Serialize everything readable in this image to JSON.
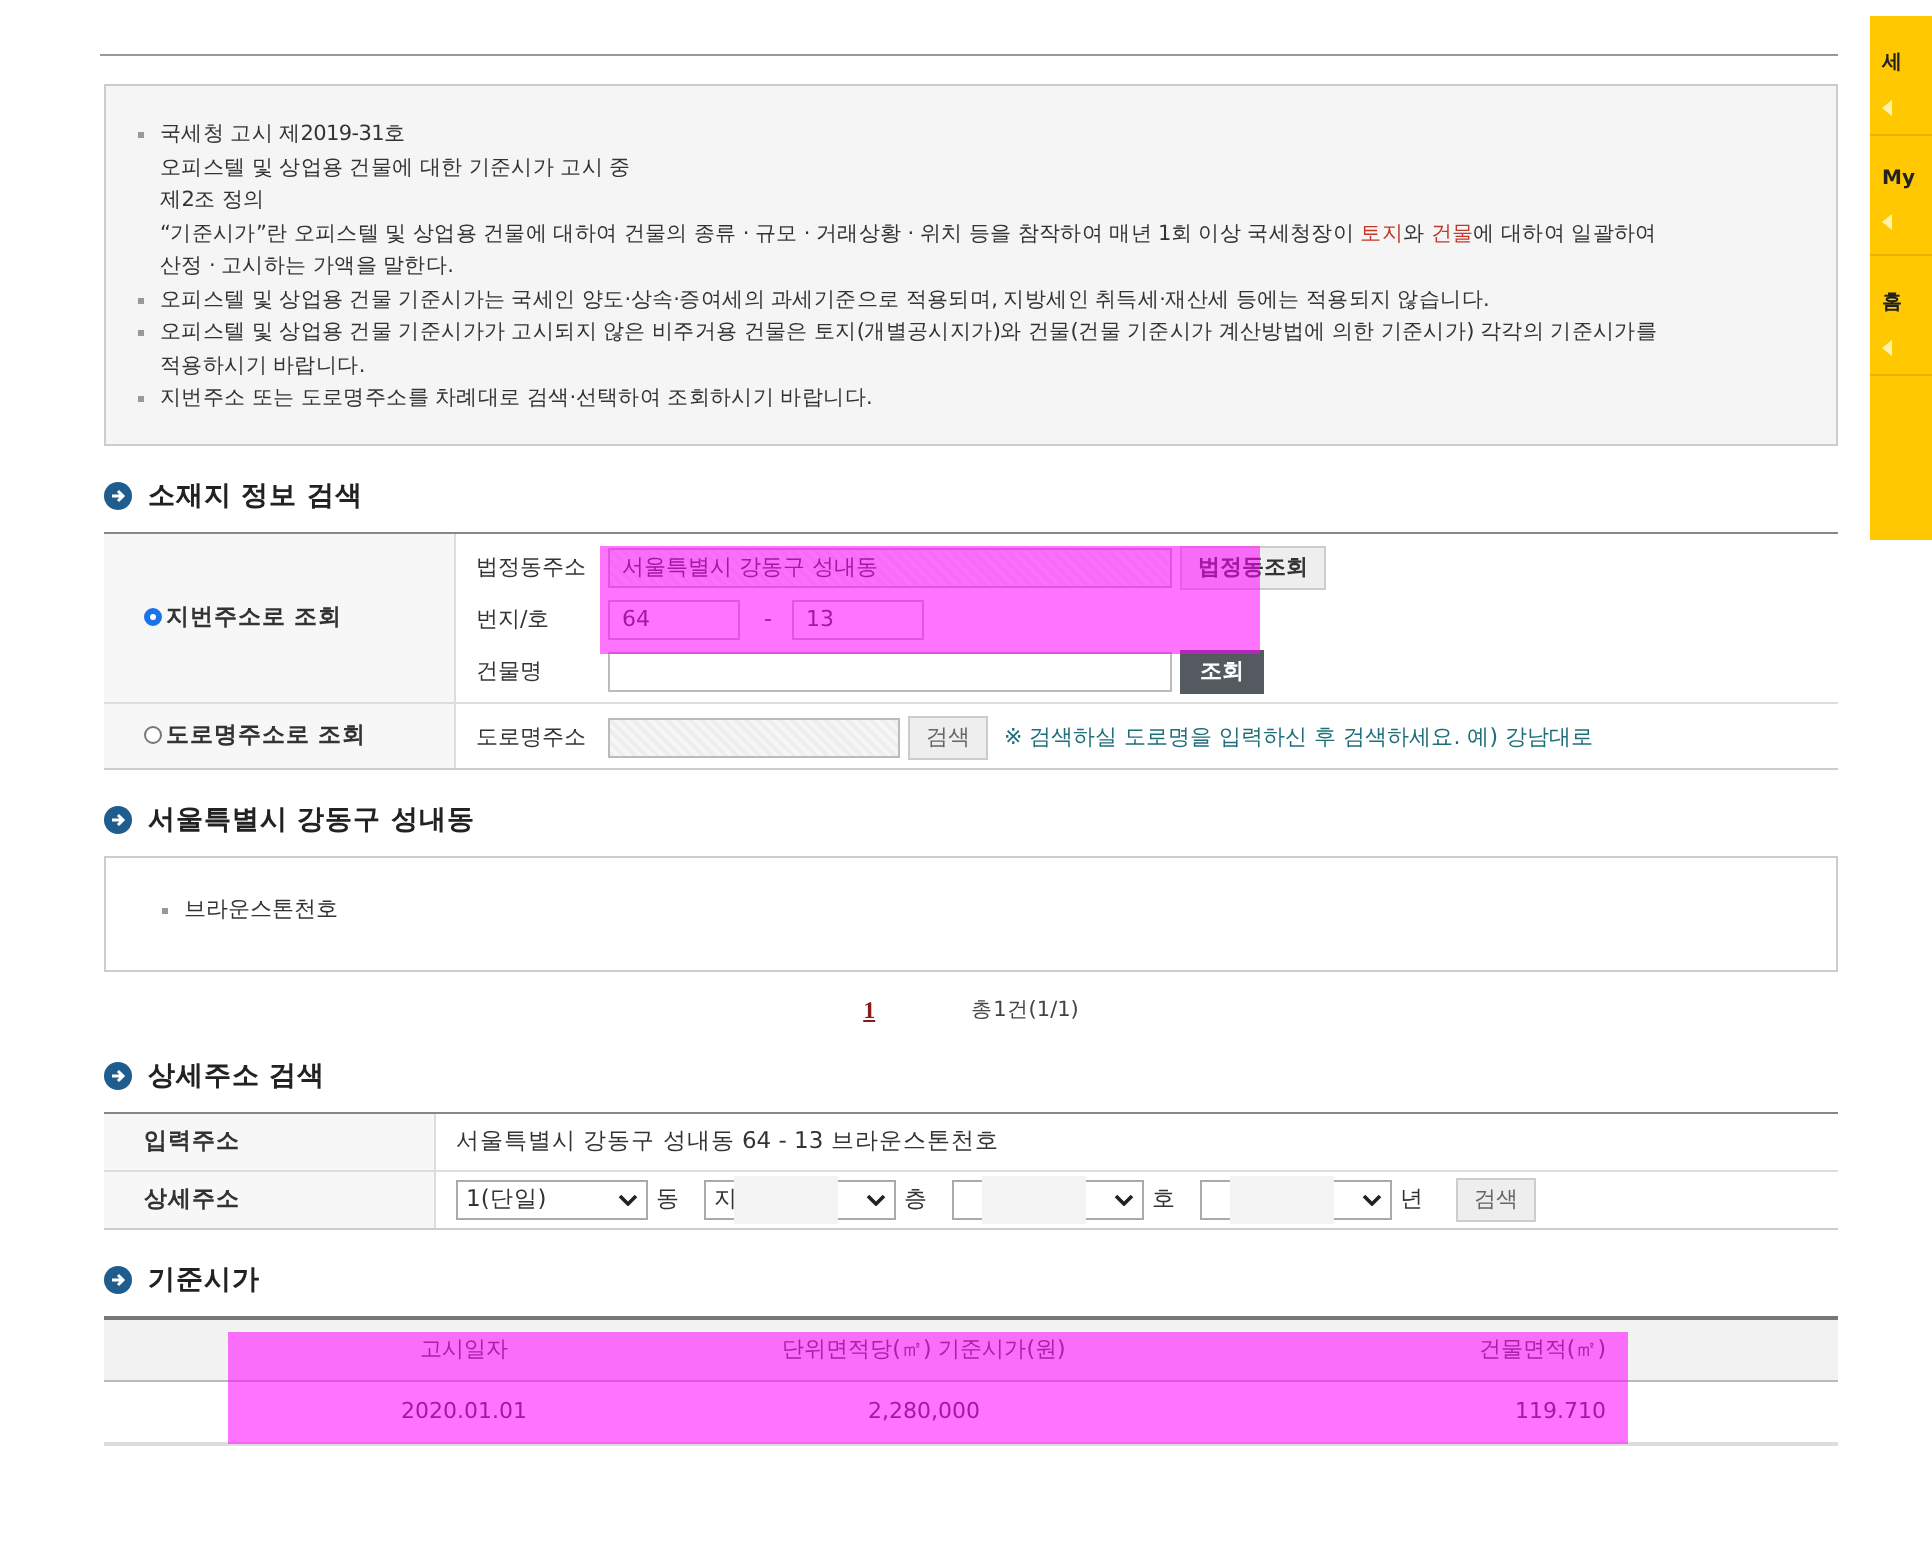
{
  "notice": {
    "items": [
      {
        "lines": [
          [
            {
              "text": "국세청 고시 제2019-31호",
              "emphasis": false
            }
          ],
          [
            {
              "text": "오피스텔 및 상업용 건물에 대한 기준시가 고시 중",
              "emphasis": false
            }
          ],
          [
            {
              "text": "제2조 정의",
              "emphasis": false
            }
          ],
          [
            {
              "text": "“기준시가”란 오피스텔 및 상업용 건물에 대하여 건물의 종류 · 규모 · 거래상황 · 위치 등을 참작하여 매년 1회 이상 국세청장이 ",
              "emphasis": false
            },
            {
              "text": "토지",
              "emphasis": true
            },
            {
              "text": "와 ",
              "emphasis": false
            },
            {
              "text": "건물",
              "emphasis": true
            },
            {
              "text": "에 대하여 일괄하여",
              "emphasis": false
            }
          ],
          [
            {
              "text": "산정 · 고시하는 가액을 말한다.",
              "emphasis": false
            }
          ]
        ]
      },
      {
        "lines": [
          [
            {
              "text": "오피스텔 및 상업용 건물 기준시가는 국세인 양도·상속·증여세의 과세기준으로 적용되며, 지방세인 취득세·재산세 등에는 적용되지 않습니다.",
              "emphasis": false
            }
          ]
        ]
      },
      {
        "lines": [
          [
            {
              "text": "오피스텔 및 상업용 건물 기준시가가 고시되지 않은 비주거용 건물은 토지(개별공시지가)와 건물(건물 기준시가 계산방법에 의한 기준시가) 각각의 기준시가를",
              "emphasis": false
            }
          ],
          [
            {
              "text": "적용하시기 바랍니다.",
              "emphasis": false
            }
          ]
        ]
      },
      {
        "lines": [
          [
            {
              "text": "지번주소 또는 도로명주소를 차례대로 검색·선택하여 조회하시기 바랍니다.",
              "emphasis": false
            }
          ]
        ]
      }
    ]
  },
  "location_search": {
    "title": "소재지 정보 검색",
    "modes": [
      {
        "label": "지번주소로 조회",
        "selected": true,
        "dong_label": "법정동주소",
        "dong_value": "서울특별시 강동구 성내동",
        "dong_button": "법정동조회",
        "lot_label": "번지/호",
        "lot_main": "64",
        "lot_sep": "-",
        "lot_sub": "13",
        "building_label": "건물명",
        "building_button": "조회"
      },
      {
        "label": "도로명주소로 조회",
        "selected": false,
        "road_label": "도로명주소",
        "road_button": "검색",
        "hint": "※ 검색하실 도로명을 입력하신 후 검색하세요. 예) 강남대로"
      }
    ]
  },
  "result": {
    "title": "서울특별시 강동구 성내동",
    "items": [
      "브라운스톤천호"
    ],
    "pages": [
      {
        "label": "1",
        "selected": true
      }
    ],
    "total": "총1건(1/1)"
  },
  "detail_search": {
    "title": "상세주소 검색",
    "input_label": "입력주소",
    "input_value": "서울특별시 강동구 성내동 64 - 13 브라운스톤천호",
    "detail_label": "상세주소",
    "selects": [
      {
        "value": "1(단일)",
        "unit": "동",
        "blurred": false
      },
      {
        "value": "지",
        "unit": "층",
        "blurred": true
      },
      {
        "unit": "호",
        "blurred": true
      },
      {
        "unit": "년",
        "blurred": true
      }
    ],
    "button": "검색"
  },
  "standard_price": {
    "title": "기준시가",
    "columns": [
      "고시일자",
      "단위면적당(㎡) 기준시가(원)",
      "건물면적(㎡)"
    ],
    "rows": [
      [
        "2020.01.01",
        "2,280,000",
        "119.710"
      ]
    ]
  },
  "side_menu": {
    "items": [
      "세",
      "My",
      "홈"
    ]
  }
}
